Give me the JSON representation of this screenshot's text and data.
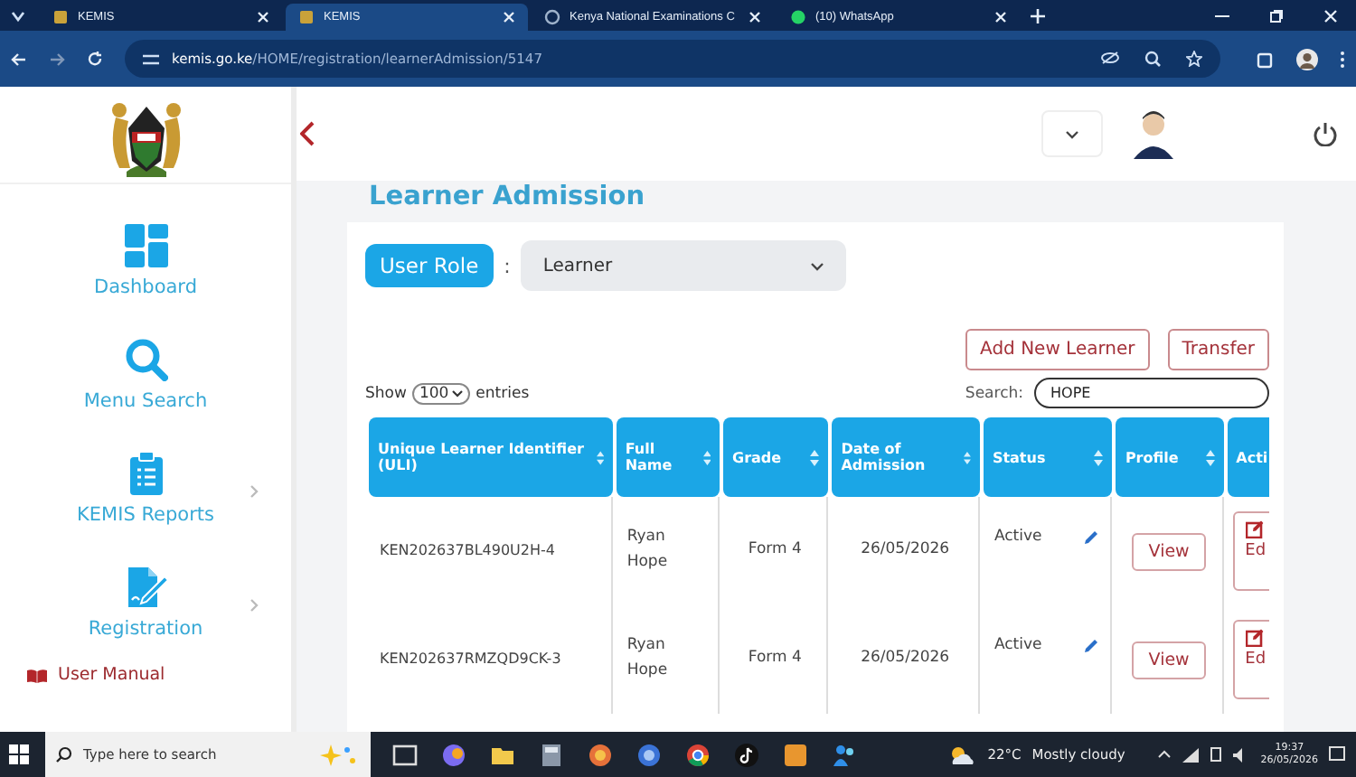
{
  "browser": {
    "tabs": [
      {
        "title": "KEMIS",
        "kind": "site",
        "selected": false
      },
      {
        "title": "KEMIS",
        "kind": "site",
        "selected": true
      },
      {
        "title": "Kenya National Examinations C",
        "kind": "globe",
        "selected": false
      },
      {
        "title": "(10) WhatsApp",
        "kind": "chat",
        "selected": false
      }
    ],
    "url_host": "kemis.go.ke",
    "url_path": "/HOME/registration/learnerAdmission/5147"
  },
  "sidebar": {
    "items": [
      {
        "label": "Dashboard",
        "kind": "dashboard",
        "has_submenu": false
      },
      {
        "label": "Menu Search",
        "kind": "search",
        "has_submenu": false
      },
      {
        "label": "KEMIS Reports",
        "kind": "reports",
        "has_submenu": true
      },
      {
        "label": "Registration",
        "kind": "registration",
        "has_submenu": true
      }
    ],
    "user_manual": "User Manual"
  },
  "page": {
    "title": "Learner Admission",
    "user_role_label": "User Role",
    "role_separator": ":",
    "role_value": "Learner",
    "buttons": [
      "Add New Learner",
      "Transfer"
    ],
    "show_label": "Show",
    "entries_value": "100",
    "entries_label": "entries",
    "search_label": "Search:",
    "search_value": "HOPE",
    "table": {
      "columns": [
        "Unique Learner Identifier (ULI)",
        "Full Name",
        "Grade",
        "Date of Admission",
        "Status",
        "Profile",
        "Acti"
      ],
      "rows": [
        {
          "uli": "KEN202637BL490U2H-4",
          "name": "Ryan Hope",
          "grade": "Form 4",
          "date": "26/05/2026",
          "status": "Active",
          "profile": "View",
          "action": "Ed"
        },
        {
          "uli": "KEN202637RMZQD9CK-3",
          "name": "Ryan Hope",
          "grade": "Form 4",
          "date": "26/05/2026",
          "status": "Active",
          "profile": "View",
          "action": "Ed"
        }
      ]
    }
  },
  "taskbar": {
    "search_placeholder": "Type here to search",
    "temperature": "22°C",
    "weather": "Mostly cloudy",
    "time": "19:37",
    "date": "26/05/2026"
  }
}
